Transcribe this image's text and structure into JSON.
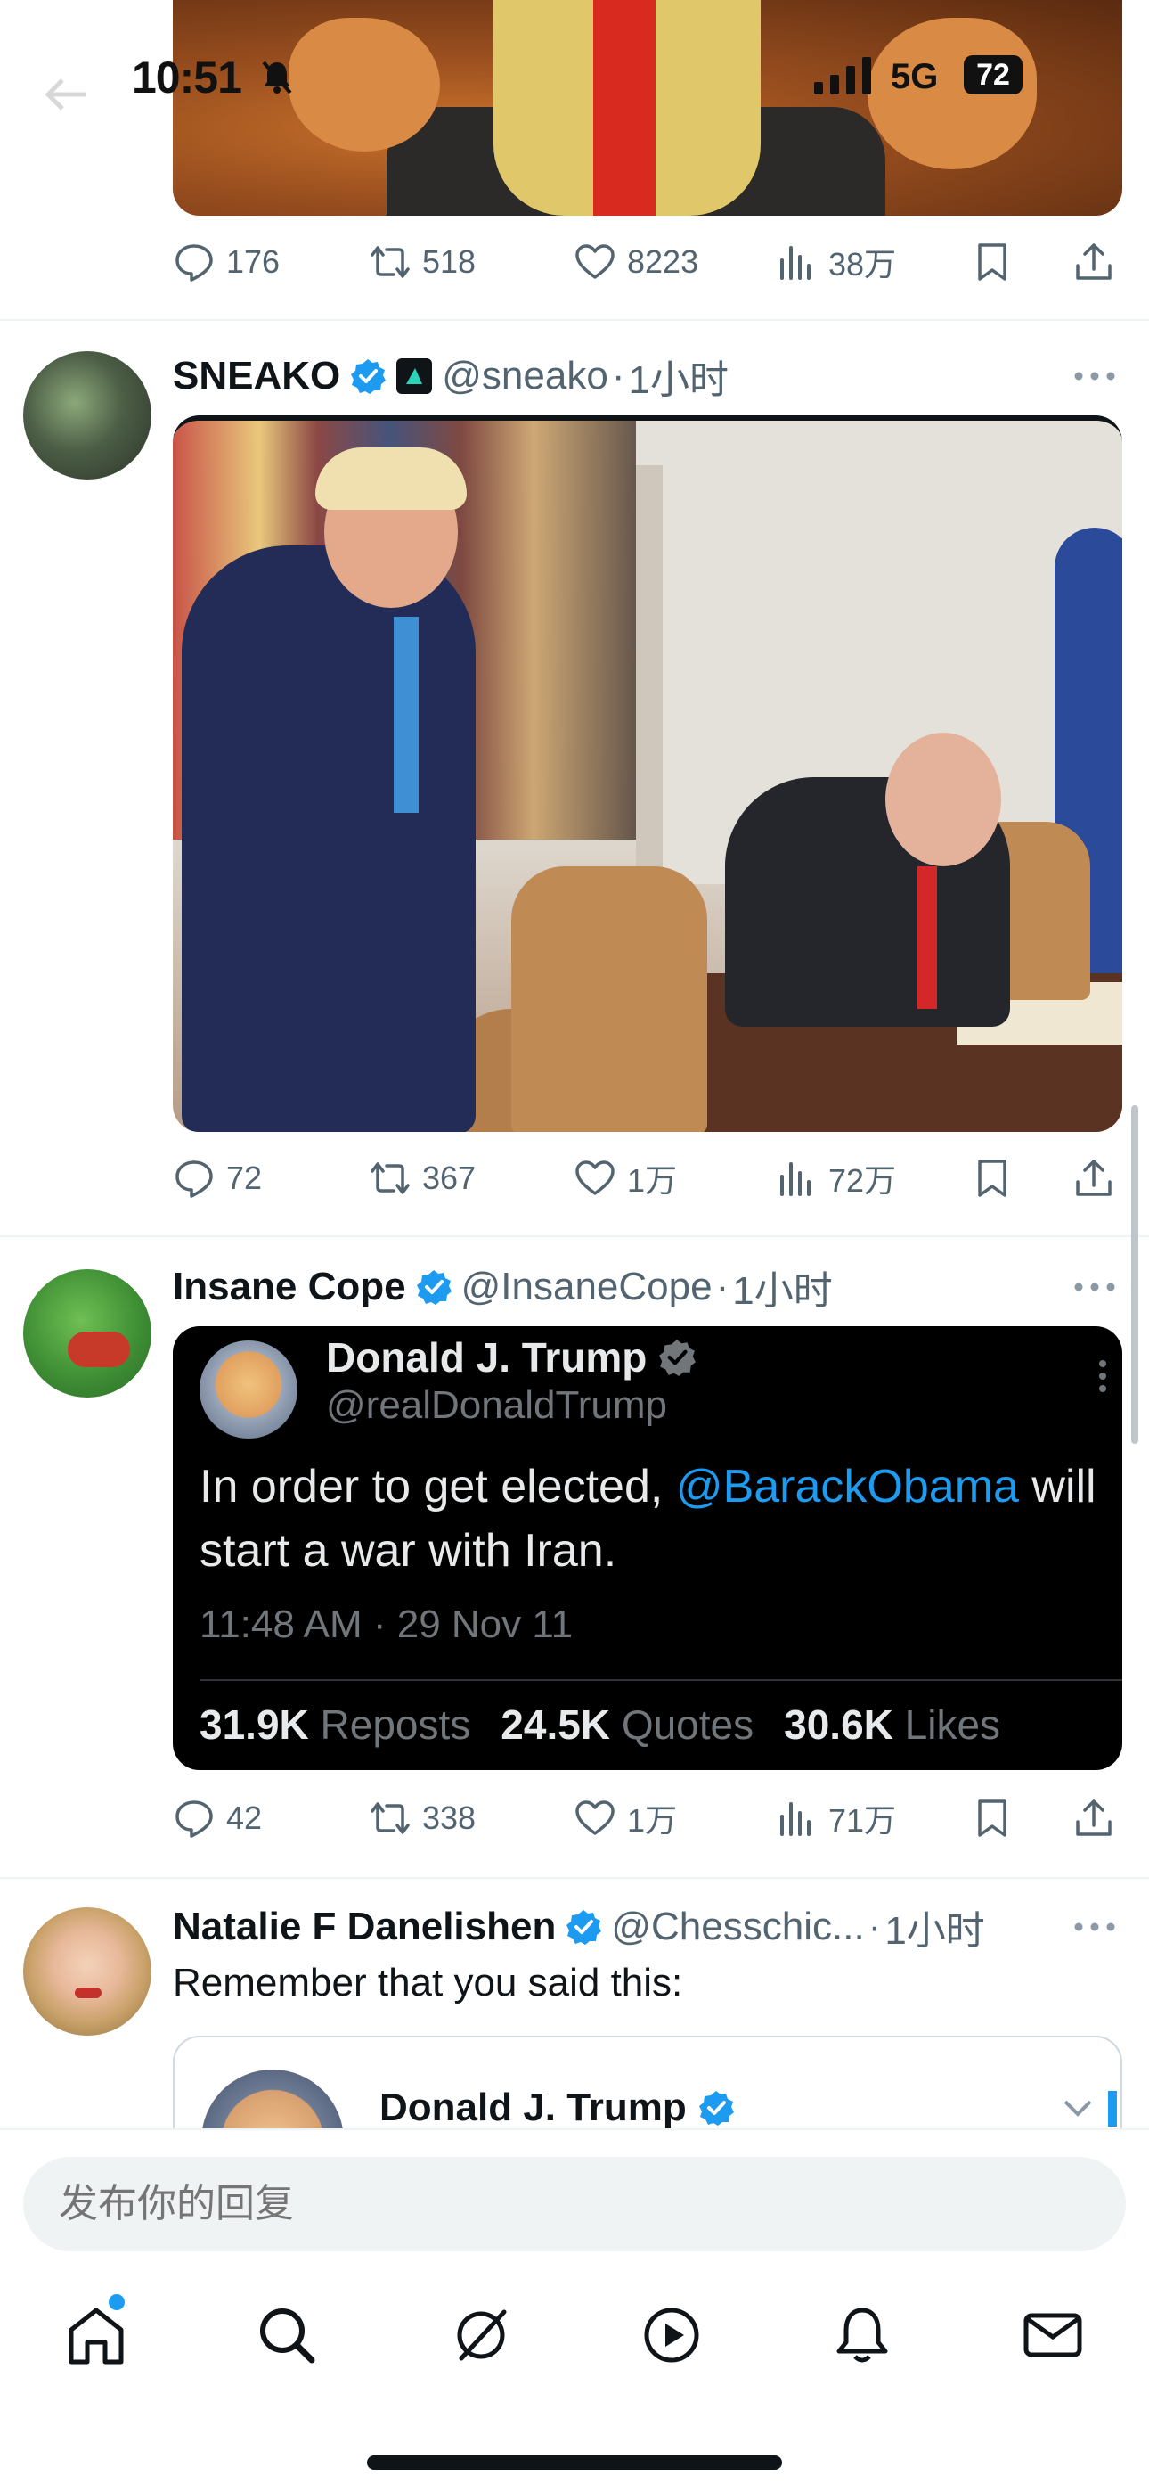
{
  "status_bar": {
    "time": "10:51",
    "network": "5G",
    "battery": "72"
  },
  "tweets": [
    {
      "stats": {
        "replies": "176",
        "reposts": "518",
        "likes": "8223",
        "views": "38万"
      }
    },
    {
      "name": "SNEAKO",
      "handle": "@sneako",
      "time": "1小时",
      "stats": {
        "replies": "72",
        "reposts": "367",
        "likes": "1万",
        "views": "72万"
      }
    },
    {
      "name": "Insane Cope",
      "handle": "@InsaneCope",
      "time": "1小时",
      "embedded": {
        "name": "Donald J. Trump",
        "handle": "@realDonaldTrump",
        "text_before": "In order to get elected, ",
        "mention": "@BarackObama",
        "text_after": " will start a war with Iran.",
        "meta": "11:48 AM · 29 Nov 11",
        "reposts_value": "31.9K",
        "reposts_label": "Reposts",
        "quotes_value": "24.5K",
        "quotes_label": "Quotes",
        "likes_value": "30.6K",
        "likes_label": "Likes"
      },
      "stats": {
        "replies": "42",
        "reposts": "338",
        "likes": "1万",
        "views": "71万"
      }
    },
    {
      "name": "Natalie F Danelishen",
      "handle": "@Chesschic...",
      "time": "1小时",
      "text": "Remember that you said this:",
      "quote": {
        "name": "Donald J. Trump"
      }
    }
  ],
  "reply": {
    "placeholder": "发布你的回复"
  },
  "separator": "·",
  "icons": [
    "home-icon",
    "search-icon",
    "grok-icon",
    "video-icon",
    "notifications-icon",
    "messages-icon"
  ],
  "colors": {
    "accent": "#1d9bf0",
    "text": "#0f1419",
    "muted": "#536471"
  }
}
